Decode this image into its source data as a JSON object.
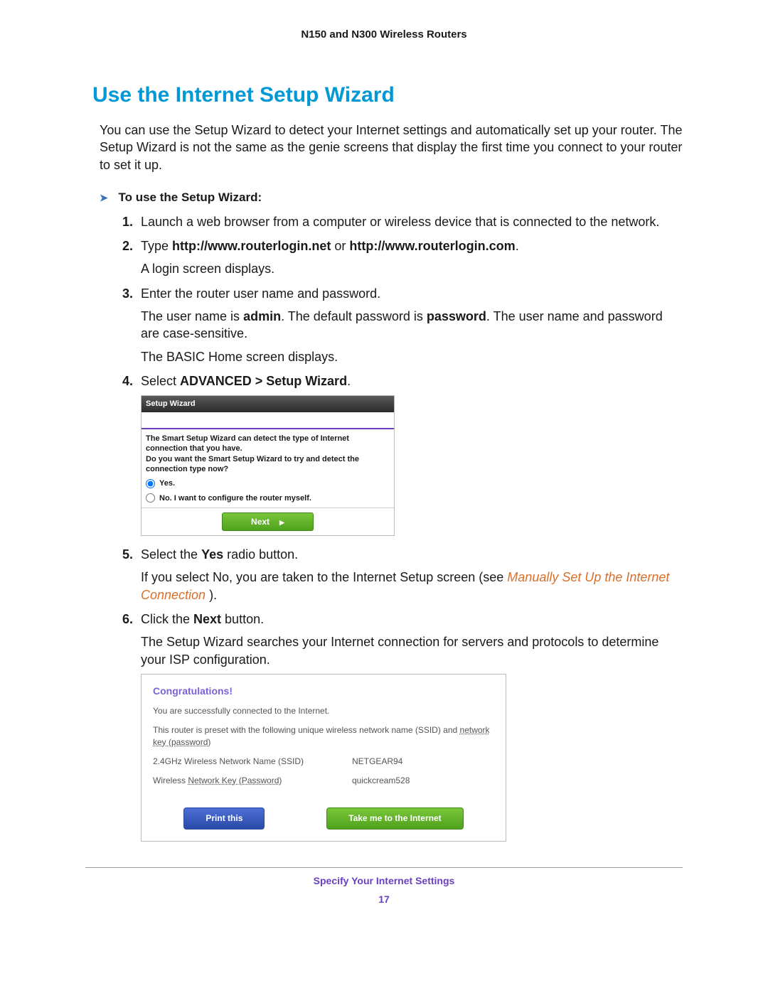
{
  "header": "N150 and N300 Wireless Routers",
  "title": "Use the Internet Setup Wizard",
  "intro": "You can use the Setup Wizard to detect your Internet settings and automatically set up your router. The Setup Wizard is not the same as the genie screens that display the first time you connect to your router to set it up.",
  "procedure_title": "To use the Setup Wizard:",
  "steps": {
    "s1": "Launch a web browser from a computer or wireless device that is connected to the network.",
    "s2_pre": "Type ",
    "s2_b1": "http://www.routerlogin.net",
    "s2_mid": " or ",
    "s2_b2": "http://www.routerlogin.com",
    "s2_post": ".",
    "s2_p": "A login screen displays.",
    "s3": "Enter the router user name and password.",
    "s3_p1a": "The user name is ",
    "s3_p1b1": "admin",
    "s3_p1c": ". The default password is ",
    "s3_p1b2": "password",
    "s3_p1d": ". The user name and password are case-sensitive.",
    "s3_p2": "The BASIC Home screen displays.",
    "s4_pre": "Select ",
    "s4_b": "ADVANCED > Setup Wizard",
    "s4_post": ".",
    "s5_pre": "Select the ",
    "s5_b": "Yes",
    "s5_post": " radio button.",
    "s5_p_pre": "If you select No, you are taken to the Internet Setup screen (see ",
    "s5_link": "Manually Set Up the Internet Connection ",
    "s5_p_post": ").",
    "s6_pre": "Click the ",
    "s6_b": "Next",
    "s6_post": " button.",
    "s6_p": "The Setup Wizard searches your Internet connection for servers and protocols to determine your ISP configuration."
  },
  "shot1": {
    "title": "Setup Wizard",
    "line1": "The Smart Setup Wizard can detect the type of Internet connection that you have.",
    "line2": "Do you want the Smart Setup Wizard to try and detect the connection type now?",
    "yes": "Yes.",
    "no": "No. I want to configure the router myself.",
    "next": "Next"
  },
  "shot2": {
    "congrats": "Congratulations!",
    "line1": "You are successfully connected to the Internet.",
    "line2_pre": "This router is preset with the following unique wireless network name (SSID) and ",
    "line2_u1": "network key (password)",
    "ssid_label": "2.4GHz Wireless Network Name (SSID)",
    "ssid_value": "NETGEAR94",
    "key_label_pre": "Wireless ",
    "key_label_u": "Network Key (Password)",
    "key_value": "quickcream528",
    "print": "Print this",
    "take": "Take me to the Internet"
  },
  "footer": {
    "title": "Specify Your Internet Settings",
    "page": "17"
  }
}
